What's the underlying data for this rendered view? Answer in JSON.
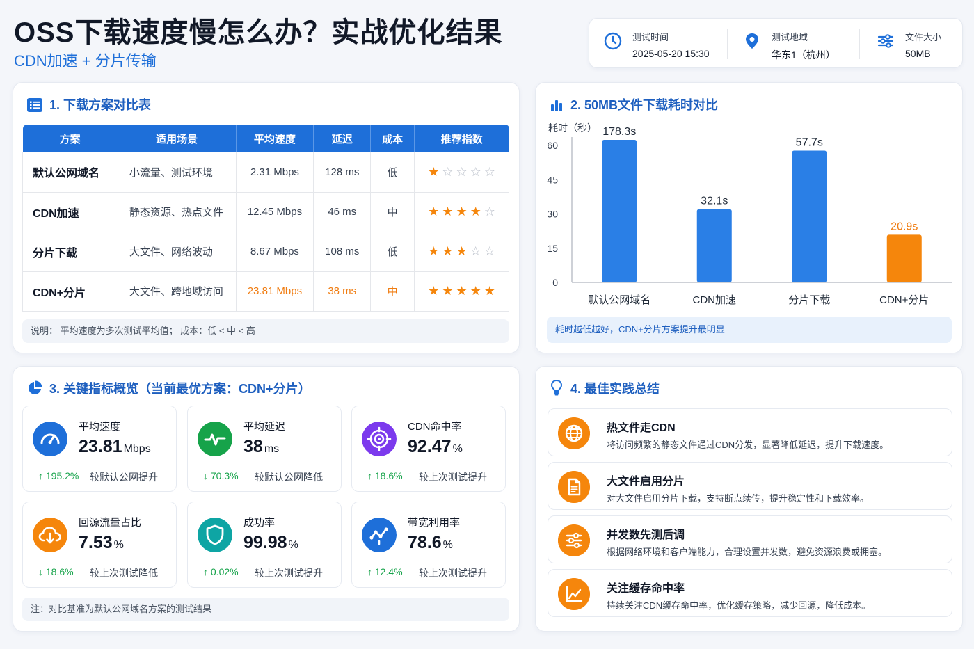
{
  "header": {
    "title": "OSS下载速度慢怎么办？实战优化结果",
    "subtitle": "CDN加速 + 分片传输"
  },
  "meta": [
    {
      "label": "测试时间",
      "value": "2025-05-20 15:30",
      "icon": "clock-icon"
    },
    {
      "label": "测试地域",
      "value": "华东1（杭州）",
      "icon": "location-pin-icon"
    },
    {
      "label": "文件大小",
      "value": "50MB",
      "icon": "sliders-icon"
    }
  ],
  "table_section": {
    "title": "1. 下载方案对比表",
    "headers": [
      "方案",
      "适用场景",
      "平均速度",
      "延迟",
      "成本",
      "推荐指数"
    ],
    "rows": [
      {
        "name": "默认公网域名",
        "scene": "小流量、测试环境",
        "speed": "2.31 Mbps",
        "latency": "128 ms",
        "cost": "低",
        "stars": 1
      },
      {
        "name": "CDN加速",
        "scene": "静态资源、热点文件",
        "speed": "12.45 Mbps",
        "latency": "46 ms",
        "cost": "中",
        "stars": 4
      },
      {
        "name": "分片下载",
        "scene": "大文件、网络波动",
        "speed": "8.67 Mbps",
        "latency": "108 ms",
        "cost": "低",
        "stars": 3
      },
      {
        "name": "CDN+分片",
        "scene": "大文件、跨地域访问",
        "speed": "23.81 Mbps",
        "latency": "38 ms",
        "cost": "中",
        "stars": 5
      }
    ],
    "note": "说明：  平均速度为多次测试平均值；  成本：低 < 中 < 高"
  },
  "chart_section": {
    "title": "2. 50MB文件下载耗时对比",
    "note": "耗时越低越好，CDN+分片方案提升最明显"
  },
  "chart_data": {
    "type": "bar",
    "ylabel": "耗时（秒）",
    "categories": [
      "默认公网域名",
      "CDN加速",
      "分片下载",
      "CDN+分片"
    ],
    "values": [
      178.3,
      32.1,
      57.7,
      20.9
    ],
    "value_labels": [
      "178.3s",
      "32.1s",
      "57.7s",
      "20.9s"
    ],
    "yticks": [
      "60",
      "45",
      "30",
      "15",
      "0"
    ],
    "ylim": [
      0,
      60
    ],
    "colors": [
      "#2a7fe6",
      "#2a7fe6",
      "#2a7fe6",
      "#f5860c"
    ],
    "grid": false
  },
  "kpi_section": {
    "title": "3. 关键指标概览（当前最优方案：CDN+分片）",
    "items": [
      {
        "label": "平均速度",
        "value": "23.81",
        "unit": "Mbps",
        "change": "↑ 195.2%",
        "desc": "较默认公网提升",
        "icon": "speedometer-icon",
        "color": "#1e6fd9"
      },
      {
        "label": "平均延迟",
        "value": "38",
        "unit": "ms",
        "change": "↓ 70.3%",
        "desc": "较默认公网降低",
        "icon": "pulse-icon",
        "color": "#16a34a"
      },
      {
        "label": "CDN命中率",
        "value": "92.47",
        "unit": "%",
        "change": "↑ 18.6%",
        "desc": "较上次测试提升",
        "icon": "target-icon",
        "color": "#7c3aed"
      },
      {
        "label": "回源流量占比",
        "value": "7.53",
        "unit": "%",
        "change": "↓ 18.6%",
        "desc": "较上次测试降低",
        "icon": "cloud-download-icon",
        "color": "#f5860c"
      },
      {
        "label": "成功率",
        "value": "99.98",
        "unit": "%",
        "change": "↑ 0.02%",
        "desc": "较上次测试提升",
        "icon": "shield-icon",
        "color": "#0ea5a4"
      },
      {
        "label": "带宽利用率",
        "value": "78.6",
        "unit": "%",
        "change": "↑ 12.4%",
        "desc": "较上次测试提升",
        "icon": "network-icon",
        "color": "#1e6fd9"
      }
    ],
    "note": "注：对比基准为默认公网域名方案的测试结果"
  },
  "practice_section": {
    "title": "4. 最佳实践总结",
    "items": [
      {
        "title": "热文件走CDN",
        "desc": "将访问频繁的静态文件通过CDN分发，显著降低延迟，提升下载速度。",
        "icon": "globe-icon"
      },
      {
        "title": "大文件启用分片",
        "desc": "对大文件启用分片下载，支持断点续传，提升稳定性和下载效率。",
        "icon": "document-icon"
      },
      {
        "title": "并发数先测后调",
        "desc": "根据网络环境和客户端能力，合理设置并发数，避免资源浪费或拥塞。",
        "icon": "sliders-icon"
      },
      {
        "title": "关注缓存命中率",
        "desc": "持续关注CDN缓存命中率，优化缓存策略，减少回源，降低成本。",
        "icon": "line-chart-icon"
      }
    ]
  }
}
